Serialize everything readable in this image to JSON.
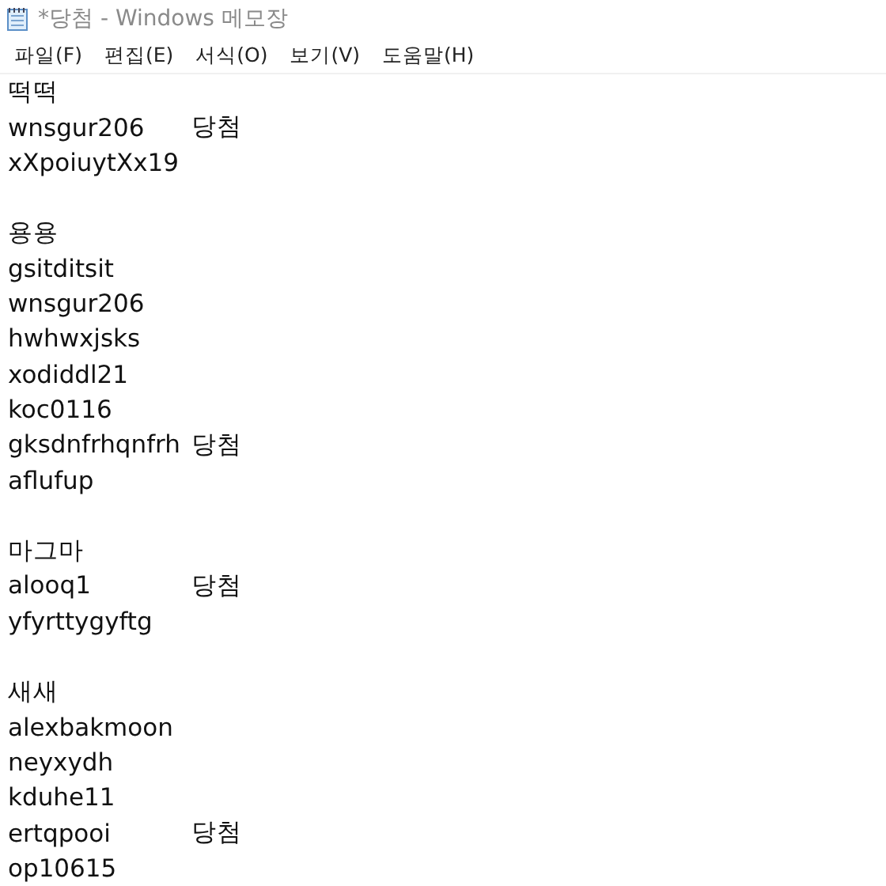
{
  "window": {
    "title": "*당첨 - Windows 메모장"
  },
  "menu": [
    "파일(F)",
    "편집(E)",
    "서식(O)",
    "보기(V)",
    "도움말(H)"
  ],
  "groups": [
    {
      "heading": "떡떡",
      "entries": [
        {
          "text": "wnsgur206",
          "tag": "당첨"
        },
        {
          "text": "xXpoiuytXx19"
        }
      ]
    },
    {
      "heading": "용용",
      "entries": [
        {
          "text": "gsitditsit"
        },
        {
          "text": "wnsgur206"
        },
        {
          "text": "hwhwxjsks"
        },
        {
          "text": "xodiddl21"
        },
        {
          "text": "koc0116"
        },
        {
          "text": "gksdnfrhqnfrh",
          "tag": "당첨"
        },
        {
          "text": "aflufup"
        }
      ]
    },
    {
      "heading": "마그마",
      "entries": [
        {
          "text": "alooq1",
          "tag": "당첨"
        },
        {
          "text": "yfyrttygyftg"
        }
      ]
    },
    {
      "heading": "새새",
      "entries": [
        {
          "text": "alexbakmoon"
        },
        {
          "text": "neyxydh"
        },
        {
          "text": "kduhe11"
        },
        {
          "text": "ertqpooi",
          "tag": "당첨"
        },
        {
          "text": "op10615"
        }
      ]
    }
  ]
}
